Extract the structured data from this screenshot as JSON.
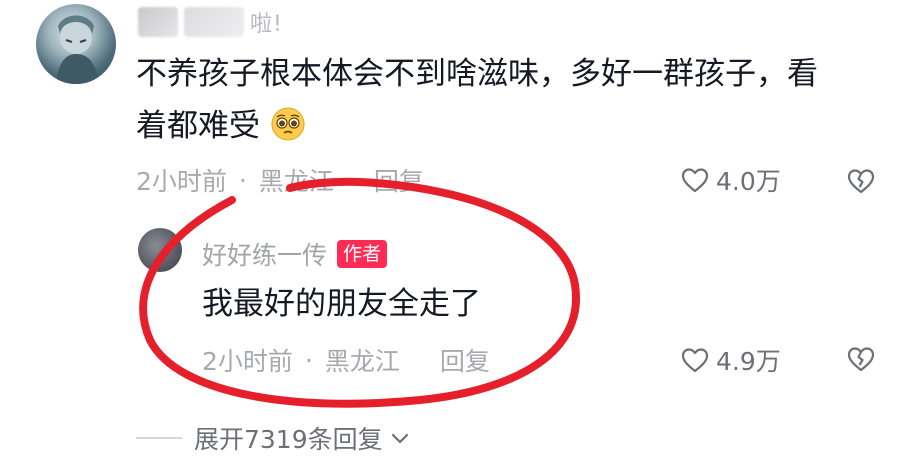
{
  "comment": {
    "name_tail": "啦!",
    "text_line1": "不养孩子根本体会不到啥滋味，多好一群孩子，看",
    "text_line2": "着都难受",
    "emoji": "pleading-face-emoji",
    "time": "2小时前",
    "dot": "·",
    "location": "黑龙江",
    "reply_label": "回复",
    "likes": "4.0万"
  },
  "reply": {
    "name": "好好练一传",
    "badge": "作者",
    "text": "我最好的朋友全走了",
    "time": "2小时前",
    "dot": "·",
    "location": "黑龙江",
    "reply_label": "回复",
    "likes": "4.9万"
  },
  "expand": {
    "label": "展开7319条回复"
  },
  "icons": {
    "like": "heart-outline-icon",
    "dislike": "broken-heart-icon",
    "expand": "chevron-down-icon"
  },
  "colors": {
    "annotation": "#e5202b",
    "badge": "#fe2c55",
    "meta_text": "#a8a9ae",
    "body_text": "#161823"
  }
}
